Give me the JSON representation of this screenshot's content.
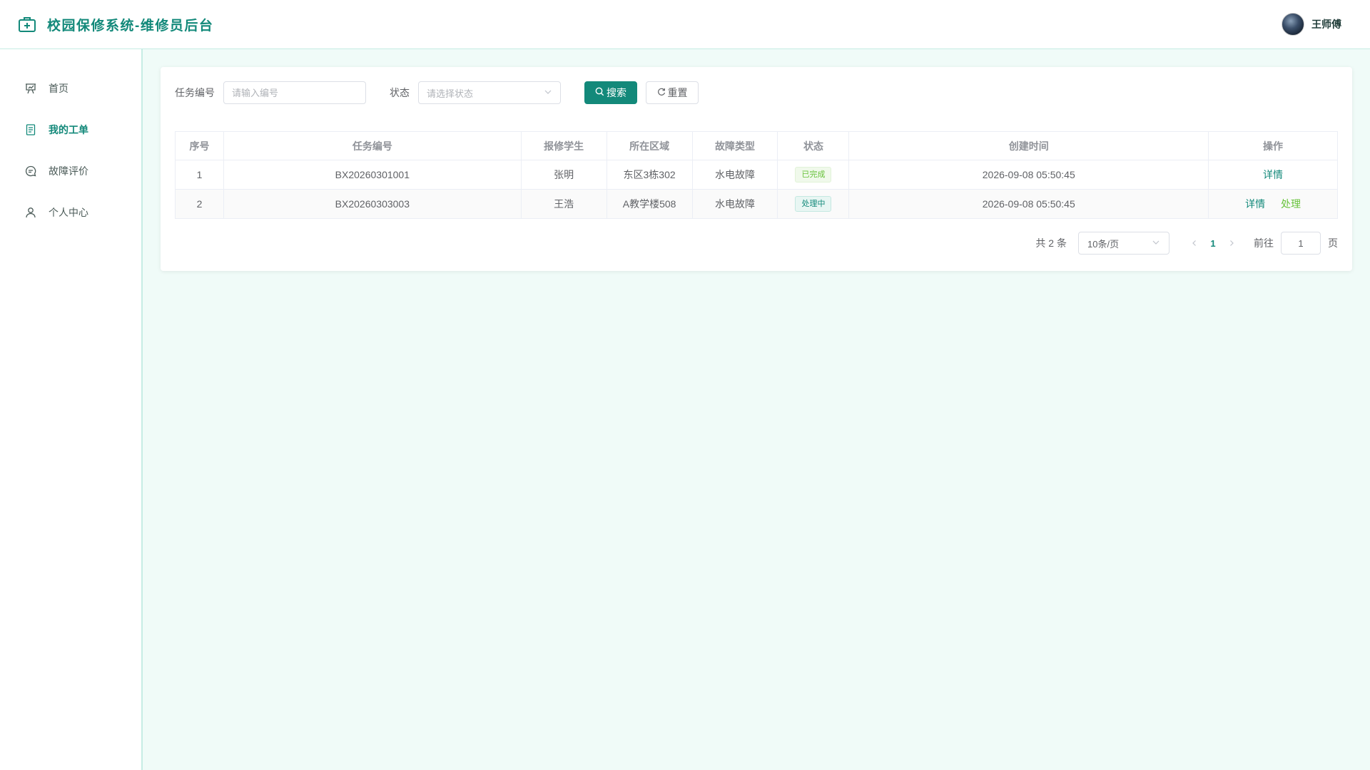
{
  "header": {
    "title": "校园保修系统-维修员后台",
    "user_name": "王师傅"
  },
  "sidebar": {
    "items": [
      {
        "label": "首页",
        "icon": "presentation-icon",
        "active": false
      },
      {
        "label": "我的工单",
        "icon": "document-icon",
        "active": true
      },
      {
        "label": "故障评价",
        "icon": "chat-icon",
        "active": false
      },
      {
        "label": "个人中心",
        "icon": "user-icon",
        "active": false
      }
    ]
  },
  "filters": {
    "task_no_label": "任务编号",
    "task_no_placeholder": "请输入编号",
    "task_no_value": "",
    "status_label": "状态",
    "status_placeholder": "请选择状态",
    "search_label": "搜索",
    "reset_label": "重置"
  },
  "table": {
    "columns": [
      "序号",
      "任务编号",
      "报修学生",
      "所在区域",
      "故障类型",
      "状态",
      "创建时间",
      "操作"
    ],
    "rows": [
      {
        "index": "1",
        "task_no": "BX20260301001",
        "student": "张明",
        "area": "东区3栋302",
        "fault_type": "水电故障",
        "status": "已完成",
        "status_kind": "success",
        "created": "2026-09-08 05:50:45",
        "actions": [
          "详情"
        ]
      },
      {
        "index": "2",
        "task_no": "BX20260303003",
        "student": "王浩",
        "area": "A教学楼508",
        "fault_type": "水电故障",
        "status": "处理中",
        "status_kind": "processing",
        "created": "2026-09-08 05:50:45",
        "actions": [
          "详情",
          "处理"
        ]
      }
    ]
  },
  "pagination": {
    "total_text": "共 2 条",
    "page_size": "10条/页",
    "current_page": "1",
    "goto_label": "前往",
    "goto_value": "1",
    "page_unit": "页"
  },
  "colors": {
    "accent": "#13897a",
    "success": "#67c23a",
    "background": "#f0fbf8"
  }
}
